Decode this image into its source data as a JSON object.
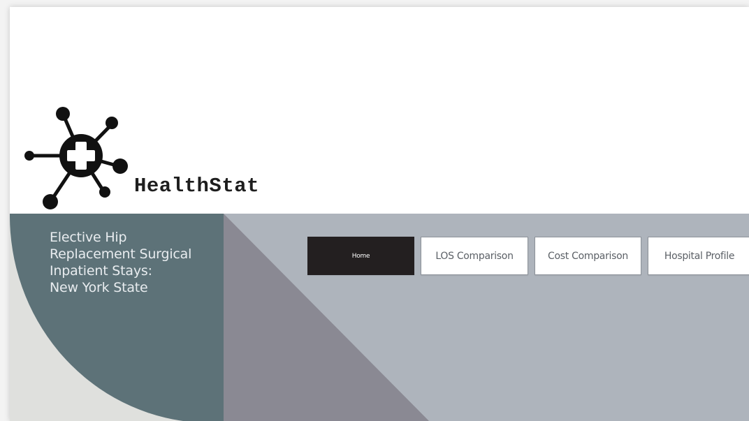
{
  "app": {
    "brand_name": "HealthStat",
    "logo_icon": "medical-network-icon"
  },
  "report": {
    "title_lines": [
      "Elective Hip",
      "Replacement Surgical",
      "Inpatient Stays:",
      "New York State"
    ]
  },
  "nav": {
    "buttons": [
      {
        "label": "Home",
        "active": true
      },
      {
        "label": "LOS Comparison",
        "active": false
      },
      {
        "label": "Cost Comparison",
        "active": false
      },
      {
        "label": "Hospital Profile",
        "active": false
      }
    ]
  },
  "colors": {
    "accent_dark": "#231f20",
    "panel_teal": "#5d7278",
    "panel_gray": "#aeb4bc",
    "panel_purple_gray": "#8a8993",
    "panel_light": "#dfe0dd"
  }
}
